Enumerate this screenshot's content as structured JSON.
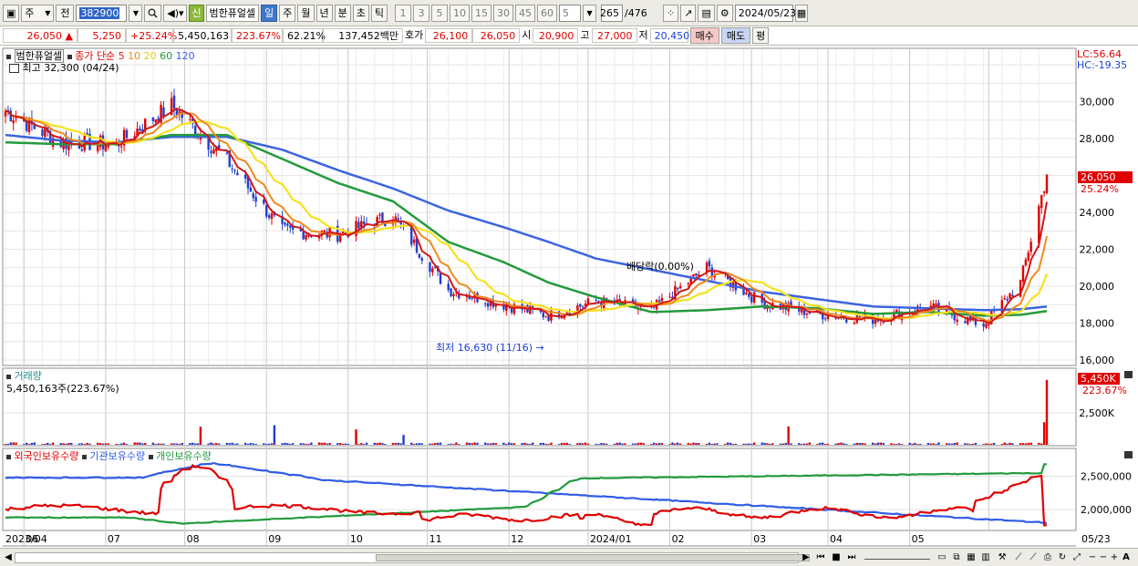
{
  "toolbar": {
    "period_label": "주",
    "prev_label": "전",
    "code": "382900",
    "stock_name": "범한퓨얼셀",
    "new_badge": "신",
    "tf_day": "일",
    "tf_week": "주",
    "tf_month": "월",
    "tf_year": "년",
    "tf_minute": "분",
    "tf_second": "초",
    "tf_tick": "틱",
    "minute_options": [
      "1",
      "3",
      "5",
      "10",
      "15",
      "30",
      "45",
      "60"
    ],
    "interval_value": "5",
    "count_current": "265",
    "count_total": "/476",
    "date": "2024/05/23"
  },
  "quote": {
    "price": "26,050",
    "up_arrow": "▲",
    "change": "5,250",
    "change_pct": "+25.24%",
    "volume": "5,450,163",
    "volume_ratio": "223.67%",
    "turnover": "62.21%",
    "amount": "137,452백만",
    "bid_label": "호가",
    "bid1": "26,100",
    "bid2": "26,050",
    "open_label": "시",
    "open": "20,900",
    "high_label": "고",
    "high": "27,000",
    "low_label": "저",
    "low": "20,450",
    "buy_label": "매수",
    "sell_label": "매도",
    "avg_label": "평"
  },
  "colors": {
    "up": "#e00000",
    "down": "#1f3fd0",
    "ma5": "#d01818",
    "ma10": "#f08a1c",
    "ma20": "#f4e21e",
    "ma60": "#249a3c",
    "ma120": "#3c64e0",
    "foreign": "#e00000",
    "institution": "#2f5ce6",
    "individual": "#249a3c"
  },
  "labels": {
    "price_panel_name": "범한퓨얼셀",
    "ma_title": "종가 단순",
    "ma_periods": [
      "5",
      "10",
      "20",
      "60",
      "120"
    ],
    "high_marker": "최고 32,300 (04/24)",
    "low_marker": "최저 16,630 (11/16)",
    "low_arrow": "→",
    "dividend_marker": "배당락(0.00%)",
    "lc_label": "LC:56.64",
    "hc_label": "HC:-19.35",
    "last_price_box": "26,050",
    "last_pct": "25.24%",
    "volume_title": "거래량",
    "volume_readout": "5,450,163주(223.67%)",
    "volume_last_box": "5,450K",
    "volume_last_pct": "223.67%",
    "holdings_foreign": "외국인보유수량",
    "holdings_inst": "기관보유수량",
    "holdings_indiv": "개인보유수량"
  },
  "chart_data": [
    {
      "type": "line",
      "panel": "price",
      "title": "범한퓨얼셀 종가 단순 5 10 20 60 120",
      "yticks": [
        "30,000",
        "28,000",
        "26,000",
        "24,000",
        "22,000",
        "20,000",
        "18,000",
        "16,000"
      ],
      "ylim": [
        15800,
        32800
      ],
      "x_month_labels": [
        "2023/04",
        "06",
        "07",
        "08",
        "09",
        "10",
        "11",
        "12",
        "2024/01",
        "02",
        "03",
        "04",
        "05",
        "05/23"
      ],
      "x": [
        "2023-04-24",
        "2023-05-15",
        "2023-06-05",
        "2023-06-26",
        "2023-07-17",
        "2023-08-07",
        "2023-08-28",
        "2023-09-18",
        "2023-10-09",
        "2023-10-30",
        "2023-11-16",
        "2023-12-04",
        "2023-12-25",
        "2024-01-15",
        "2024-02-05",
        "2024-02-26",
        "2024-03-18",
        "2024-04-08",
        "2024-04-29",
        "2024-05-13",
        "2024-05-23"
      ],
      "close": [
        29500,
        27800,
        27700,
        29800,
        26800,
        23000,
        22800,
        23800,
        19800,
        19000,
        18400,
        19200,
        18700,
        21000,
        19100,
        18500,
        18200,
        18900,
        17900,
        20200,
        26050
      ],
      "series": [
        {
          "name": "120",
          "values": [
            28200,
            27900,
            27800,
            28100,
            28100,
            27400,
            26300,
            25300,
            24100,
            23200,
            22400,
            21500,
            20900,
            20300,
            19700,
            19300,
            18900,
            18800,
            18700,
            18750,
            18900
          ]
        },
        {
          "name": "60",
          "values": [
            27800,
            27700,
            27700,
            28200,
            28200,
            26900,
            25600,
            24600,
            22400,
            21300,
            20200,
            19400,
            18600,
            18700,
            18900,
            18800,
            18500,
            18600,
            18400,
            18450,
            18650
          ]
        }
      ],
      "last_price": 26050,
      "last_change_pct": 25.24,
      "high": 32300,
      "high_date": "04/24",
      "low": 16630,
      "low_date": "11/16"
    },
    {
      "type": "bar",
      "panel": "volume",
      "title": "거래량",
      "ytick": "2,500K",
      "last_volume": 5450163,
      "last_volume_ratio_pct": 223.67
    },
    {
      "type": "line",
      "panel": "holdings",
      "series_names": [
        "외국인보유수량",
        "기관보유수량",
        "개인보유수량"
      ],
      "yticks": [
        "2,500,000",
        "2,000,000"
      ],
      "ylim": [
        1700000,
        2850000
      ]
    }
  ]
}
